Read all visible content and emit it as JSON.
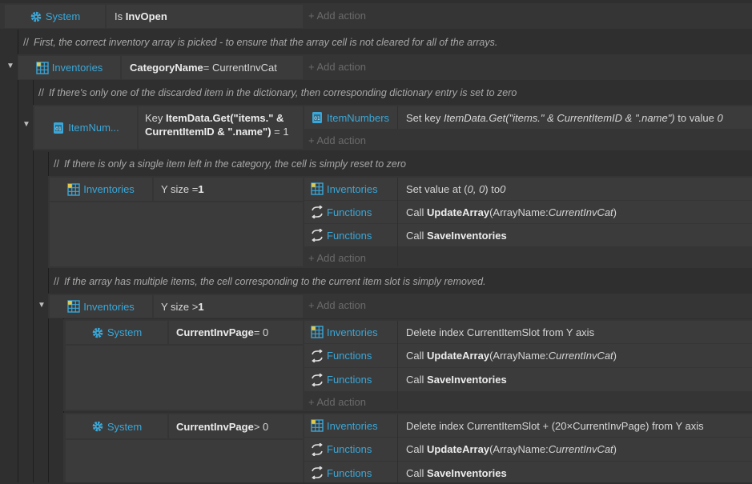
{
  "add_action": "+ Add action",
  "comment_slashes": "//",
  "blocks": {
    "b1": {
      "obj": "System",
      "cond_prefix": "Is ",
      "cond_bold": "InvOpen",
      "cond_suffix": ""
    },
    "b2": {
      "obj": "Inventories",
      "cond_prefix": "",
      "cond_bold": "CategoryName",
      "cond_suffix": " = CurrentInvCat"
    },
    "b3": {
      "obj": "ItemNum...",
      "cond_line1_prefix": "Key ",
      "cond_line1_bold": "ItemData.Get(\"items.\" &",
      "cond_line2_bold": "CurrentItemID & \".name\")",
      "cond_line2_suffix": " = 1",
      "act1_obj": "ItemNumbers",
      "act1_prefix": "Set key ",
      "act1_italic": "ItemData.Get(\"items.\" & CurrentItemID & \".name\")",
      "act1_mid": " to value ",
      "act1_italic2": "0"
    },
    "b4": {
      "obj": "Inventories",
      "cond_prefix": "Y size = ",
      "cond_bold": "1",
      "act1_obj": "Inventories",
      "act1_prefix": "Set value at (",
      "act1_italic": "0, 0",
      "act1_mid": ") to ",
      "act1_italic2": "0",
      "act2_obj": "Functions",
      "act2_prefix": "Call ",
      "act2_bold": "UpdateArray",
      "act2_mid": " (ArrayName: ",
      "act2_italic": "CurrentInvCat",
      "act2_suffix": ")",
      "act3_obj": "Functions",
      "act3_prefix": "Call ",
      "act3_bold": "SaveInventories"
    },
    "b5": {
      "obj": "Inventories",
      "cond_prefix": "Y size > ",
      "cond_bold": "1"
    },
    "b6": {
      "obj": "System",
      "cond_bold": "CurrentInvPage",
      "cond_suffix": " = 0",
      "act1_obj": "Inventories",
      "act1_text": "Delete index CurrentItemSlot from Y axis",
      "act2_obj": "Functions",
      "act2_prefix": "Call ",
      "act2_bold": "UpdateArray",
      "act2_mid": " (ArrayName: ",
      "act2_italic": "CurrentInvCat",
      "act2_suffix": ")",
      "act3_obj": "Functions",
      "act3_prefix": "Call ",
      "act3_bold": "SaveInventories"
    },
    "b7": {
      "obj": "System",
      "cond_bold": "CurrentInvPage",
      "cond_suffix": " > 0",
      "act1_obj": "Inventories",
      "act1_text": "Delete index CurrentItemSlot + (20×CurrentInvPage) from Y axis",
      "act2_obj": "Functions",
      "act2_prefix": "Call ",
      "act2_bold": "UpdateArray",
      "act2_mid": " (ArrayName: ",
      "act2_italic": "CurrentInvCat",
      "act2_suffix": ")",
      "act3_obj": "Functions",
      "act3_prefix": "Call ",
      "act3_bold": "SaveInventories"
    }
  },
  "comments": {
    "c1": "First, the correct inventory array is picked - to ensure that the array cell is not cleared for all of the arrays.",
    "c2": "If there's only one of the discarded item in the dictionary,  then corresponding dictionary entry is set to zero",
    "c3": "If there is only a single item left in the category, the cell is simply reset to zero",
    "c4": "If the array has multiple items, the cell corresponding to the current item slot is simply removed."
  },
  "icons": {
    "system": "gear-icon",
    "array": "grid-icon",
    "dictionary": "dictionary-icon",
    "function": "function-arrows-icon",
    "toggle": "collapse-triangle-icon"
  },
  "colors": {
    "object_name": "#3aa7d8",
    "background": "#2f2f2f",
    "cell": "#3b3b3b",
    "block": "#353535"
  }
}
